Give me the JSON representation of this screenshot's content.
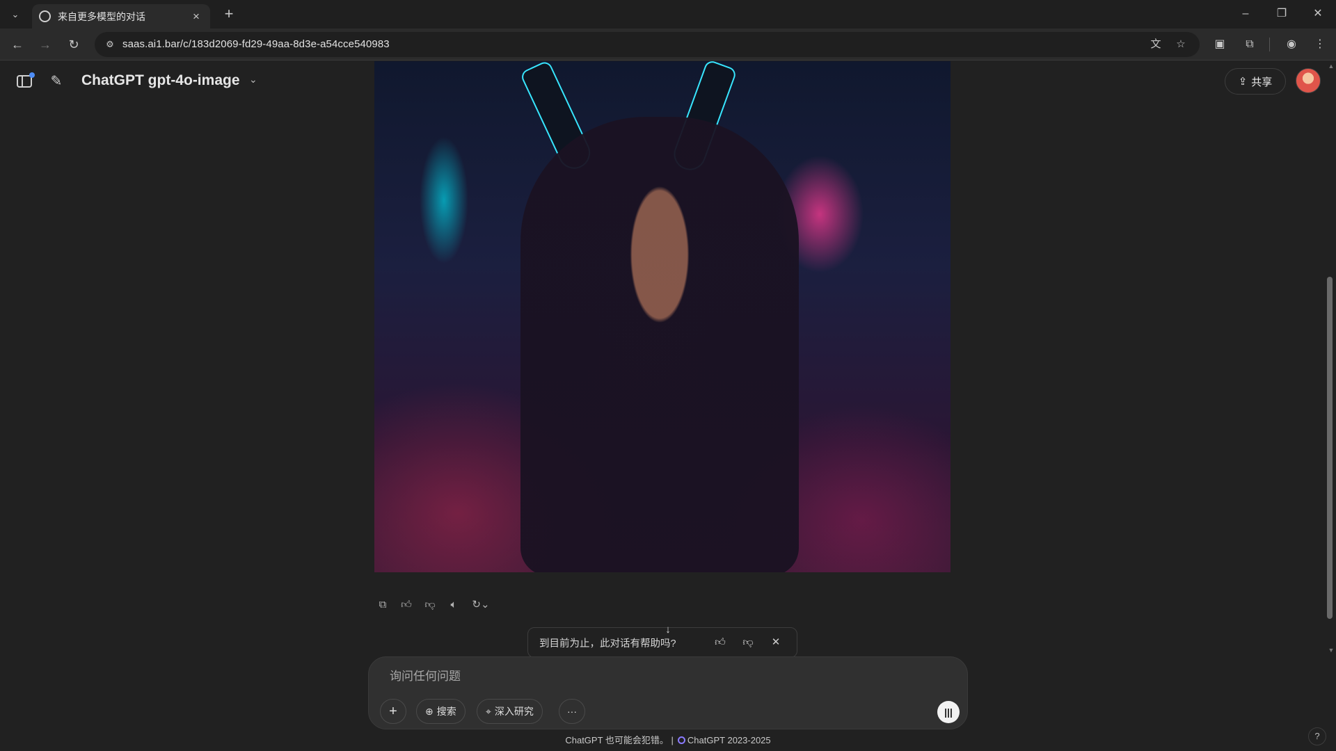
{
  "browser": {
    "tab_title": "来自更多模型的对话",
    "url": "saas.ai1.bar/c/183d2069-fd29-49aa-8d3e-a54cce540983"
  },
  "header": {
    "model_title": "ChatGPT gpt-4o-image",
    "share_label": "共享"
  },
  "feedback": {
    "question": "到目前为止，此对话有帮助吗?"
  },
  "composer": {
    "placeholder": "询问任何问题",
    "search_label": "搜索",
    "research_label": "深入研究"
  },
  "footer": {
    "disclaimer": "ChatGPT 也可能会犯错。 |",
    "copyright": "ChatGPT 2023-2025"
  },
  "icons": {
    "copy": "copy-icon",
    "like": "thumbs-up-icon",
    "dislike": "thumbs-down-icon",
    "read_aloud": "speaker-icon",
    "regenerate": "refresh-icon"
  },
  "colors": {
    "background": "#212121",
    "composer": "#303030",
    "accent": "#4d8cf5"
  }
}
